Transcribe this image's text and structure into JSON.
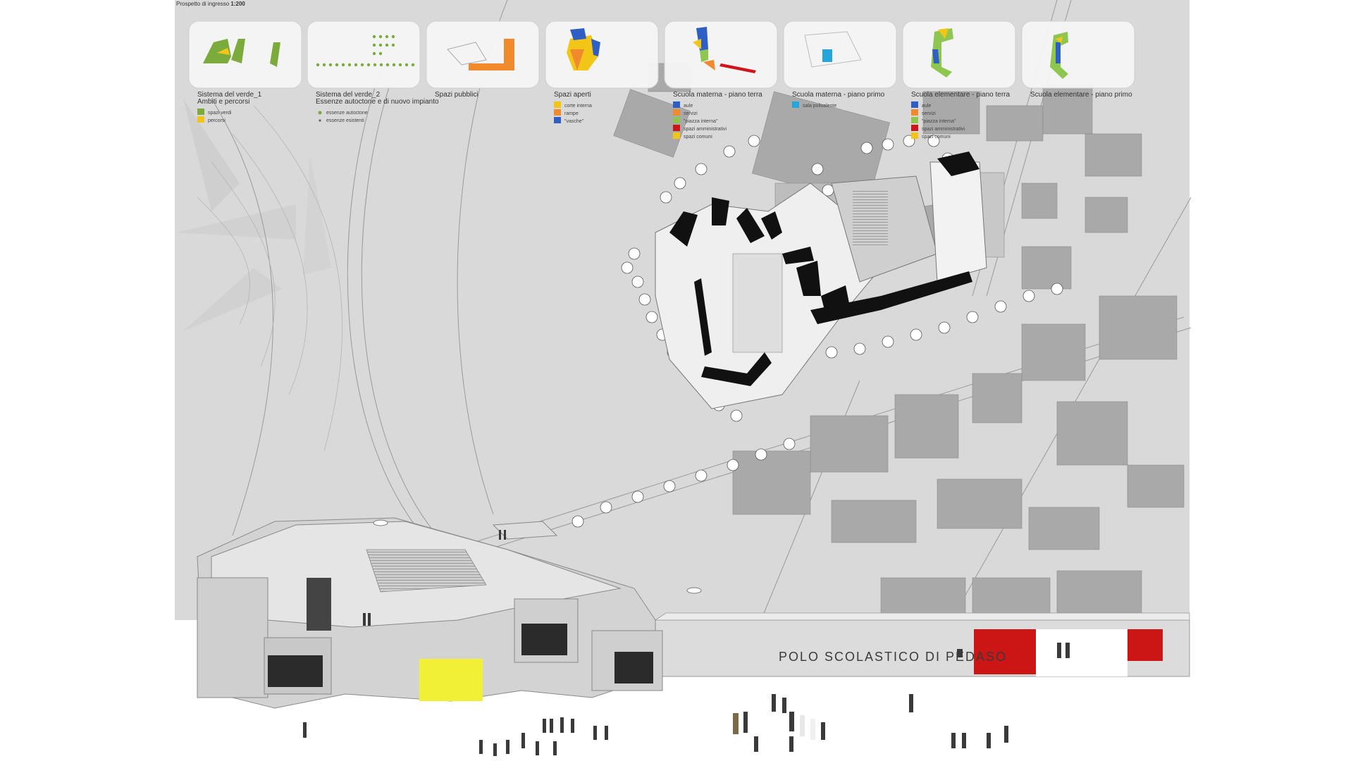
{
  "header": {
    "label": "Prospetto di ingresso",
    "scale": "1:200"
  },
  "colors": {
    "background": "#d7d7d7",
    "green": "#7aab3c",
    "yellow": "#f2c617",
    "orange": "#f08a2c",
    "blue": "#2f5fc5",
    "red": "#d0141b",
    "cyan": "#26a6d8",
    "light_green": "#8ec650",
    "façade_red": "#cc1515",
    "façade_yellow": "#f1ef36"
  },
  "cards": [
    {
      "title_lines": [
        "Sistema del verde_1",
        "Ambiti e percorsi"
      ],
      "legend": [
        {
          "color": "green",
          "label": "spazi verdi"
        },
        {
          "color": "yellow",
          "label": "percorsi"
        }
      ]
    },
    {
      "title_lines": [
        "Sistema del verde_2",
        "Essenze autoctone e di nuovo impianto"
      ],
      "legend": [
        {
          "color": "dot",
          "label": "essenze autoctone"
        },
        {
          "color": "dot-small",
          "label": "essenze esistenti"
        }
      ]
    },
    {
      "title_lines": [
        "Spazi pubblici"
      ],
      "legend": []
    },
    {
      "title_lines": [
        "Spazi aperti"
      ],
      "legend": [
        {
          "color": "yellow",
          "label": "corte interna"
        },
        {
          "color": "orange",
          "label": "rampe"
        },
        {
          "color": "blue",
          "label": "\"vasche\""
        }
      ]
    },
    {
      "title_lines": [
        "Scuola materna - piano terra"
      ],
      "legend": [
        {
          "color": "blue",
          "label": "aule"
        },
        {
          "color": "orange",
          "label": "servizi"
        },
        {
          "color": "light_green",
          "label": "\"piazza interna\""
        },
        {
          "color": "red",
          "label": "spazi amministrativi"
        },
        {
          "color": "yellow",
          "label": "spazi comuni"
        }
      ]
    },
    {
      "title_lines": [
        "Scuola materna - piano primo"
      ],
      "legend": [
        {
          "color": "cyan",
          "label": "sala polivalente"
        }
      ]
    },
    {
      "title_lines": [
        "Scuola elementare - piano terra"
      ],
      "legend": [
        {
          "color": "blue",
          "label": "aule"
        },
        {
          "color": "orange",
          "label": "servizi"
        },
        {
          "color": "light_green",
          "label": "\"piazza interna\""
        },
        {
          "color": "red",
          "label": "spazi amministrativi"
        },
        {
          "color": "yellow",
          "label": "spazi comuni"
        }
      ]
    },
    {
      "title_lines": [
        "Scuola elementare - piano primo"
      ],
      "legend": []
    }
  ],
  "building": {
    "sign": "POLO SCOLASTICO DI PEDASO"
  }
}
